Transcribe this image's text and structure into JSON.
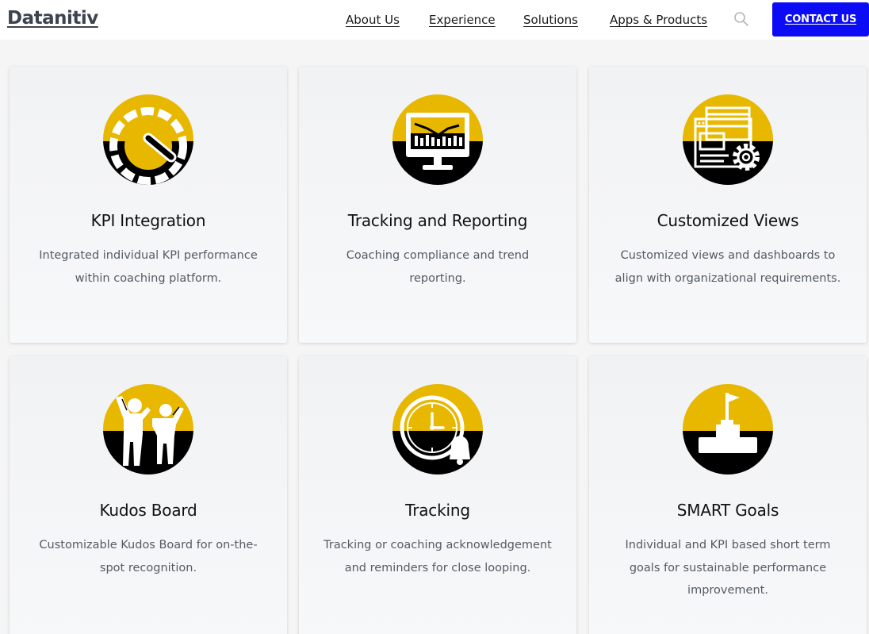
{
  "header": {
    "logo": "Datanitiv",
    "nav": [
      "About Us",
      "Experience",
      "Solutions",
      "Apps & Products"
    ],
    "search_icon": "search-icon",
    "contact_label": "CONTACT US"
  },
  "colors": {
    "accent_yellow": "#e8b800",
    "icon_black": "#000000",
    "contact_blue": "#0b0bf5"
  },
  "cards": [
    {
      "icon": "gauge-icon",
      "title": "KPI Integration",
      "desc": "Integrated individual KPI performance within coaching platform."
    },
    {
      "icon": "monitor-chart-icon",
      "title": "Tracking and Reporting",
      "desc": "Coaching compliance and trend reporting."
    },
    {
      "icon": "browser-gear-icon",
      "title": "Customized Views",
      "desc": "Customized views and dashboards to align with organizational requirements."
    },
    {
      "icon": "celebrating-people-icon",
      "title": "Kudos Board",
      "desc": "Customizable Kudos Board for on-the-spot recognition."
    },
    {
      "icon": "clock-bell-icon",
      "title": "Tracking",
      "desc": "Tracking or coaching acknowledgement and reminders for close looping."
    },
    {
      "icon": "flag-podium-icon",
      "title": "SMART Goals",
      "desc": "Individual and KPI based short term goals for sustainable performance improvement."
    }
  ]
}
